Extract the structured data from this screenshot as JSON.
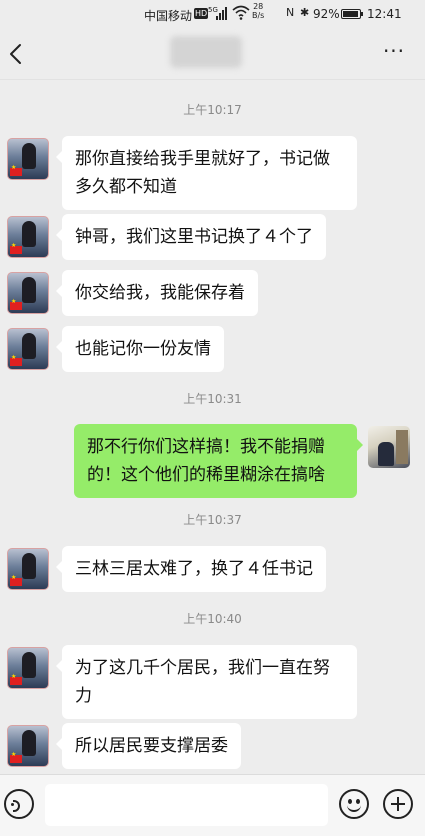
{
  "status_bar": {
    "carrier": "中国移动",
    "hd_badge": "HD",
    "network": "5G",
    "speed_value": "28",
    "speed_unit": "B/s",
    "nfc": "N",
    "bluetooth": "✱",
    "battery_text": "92%",
    "battery_level": 0.92,
    "time": "12:41"
  },
  "nav": {
    "back_icon": "chevron-left-icon",
    "more_icon": "more-dots-icon",
    "more_label": "···"
  },
  "timestamps": [
    "上午10:17",
    "上午10:31",
    "上午10:37",
    "上午10:40"
  ],
  "messages": [
    {
      "sender": "other",
      "text": "那你直接给我手里就好了，书记做多久都不知道"
    },
    {
      "sender": "other",
      "text": "钟哥，我们这里书记换了４个了"
    },
    {
      "sender": "other",
      "text": "你交给我，我能保存着"
    },
    {
      "sender": "other",
      "text": "也能记你一份友情"
    },
    {
      "sender": "me",
      "text": "那不行你们这样搞！我不能捐赠的！这个他们的稀里糊涂在搞啥"
    },
    {
      "sender": "other",
      "text": "三林三居太难了，换了４任书记"
    },
    {
      "sender": "other",
      "text": "为了这几千个居民，我们一直在努力"
    },
    {
      "sender": "other",
      "text": "所以居民要支撑居委"
    }
  ],
  "input_bar": {
    "voice_icon": "voice-icon",
    "input_value": "",
    "emoji_icon": "emoji-icon",
    "plus_icon": "plus-icon"
  },
  "colors": {
    "background": "#ededed",
    "bubble_in": "#ffffff",
    "bubble_out": "#95ec69"
  }
}
